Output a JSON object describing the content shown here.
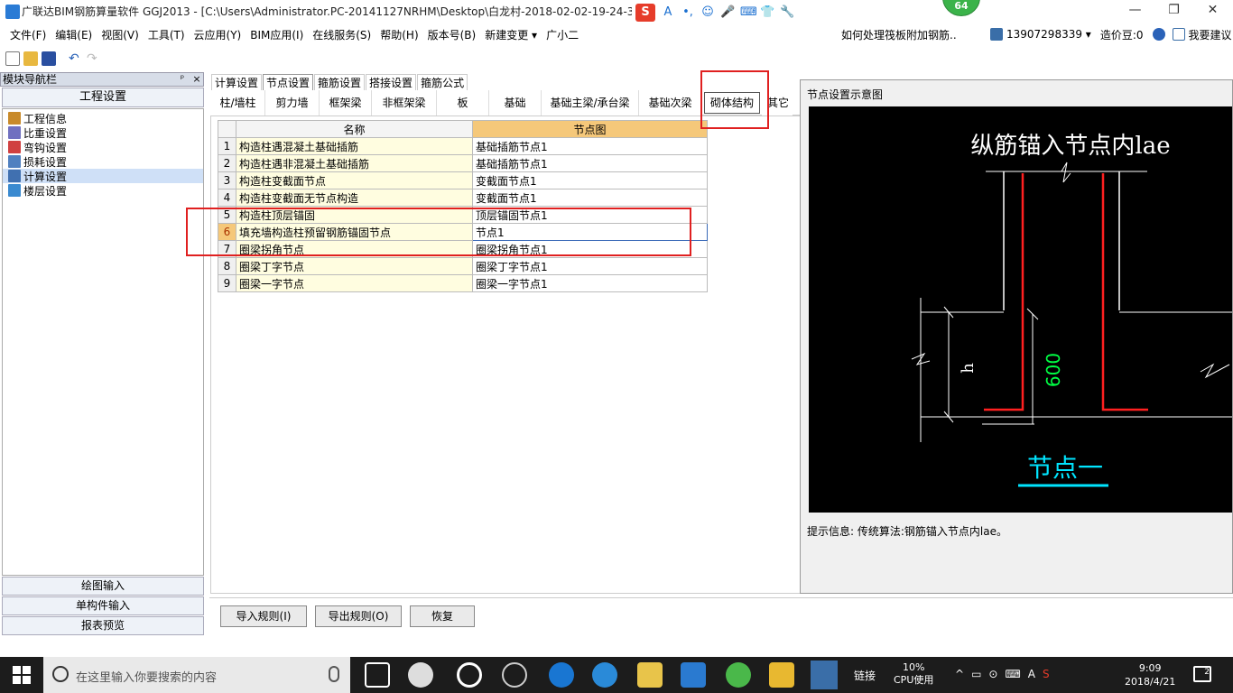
{
  "window": {
    "title": "广联达BIM钢筋算量软件 GGJ2013 - [C:\\Users\\Administrator.PC-20141127NRHM\\Desktop\\白龙村-2018-02-02-19-24-35",
    "badge": "64",
    "controls": [
      "—",
      "❐",
      "✕"
    ]
  },
  "ime": {
    "logo": "S",
    "items": [
      "A",
      "•,",
      "☺",
      "🎤",
      "⌨",
      "👕",
      "🔧"
    ]
  },
  "menu": {
    "items": [
      "文件(F)",
      "编辑(E)",
      "视图(V)",
      "工具(T)",
      "云应用(Y)",
      "BIM应用(I)",
      "在线服务(S)",
      "帮助(H)",
      "版本号(B)",
      "新建变更 ▾",
      "广小二"
    ],
    "help_link": "如何处理筏板附加钢筋..",
    "phone": "13907298339 ▾",
    "beans": "造价豆:0",
    "suggest": "我要建议"
  },
  "sidebar": {
    "header": "模块导航栏",
    "pin": "ᵖ",
    "close": "×",
    "section_title": "工程设置",
    "tree": [
      {
        "label": "工程信息",
        "icon": "info-icon",
        "color": "#c88a2a"
      },
      {
        "label": "比重设置",
        "icon": "weight-icon",
        "color": "#7070c0"
      },
      {
        "label": "弯钩设置",
        "icon": "hook-icon",
        "color": "#d04040"
      },
      {
        "label": "损耗设置",
        "icon": "loss-icon",
        "color": "#5080c0"
      },
      {
        "label": "计算设置",
        "icon": "calc-icon",
        "color": "#4070b0"
      },
      {
        "label": "楼层设置",
        "icon": "floor-icon",
        "color": "#3a8ad0"
      }
    ],
    "bottom_buttons": [
      "绘图输入",
      "单构件输入",
      "报表预览"
    ]
  },
  "main_tabs": [
    "计算设置",
    "节点设置",
    "箍筋设置",
    "搭接设置",
    "箍筋公式"
  ],
  "sub_tabs": [
    "柱/墙柱",
    "剪力墙",
    "框架梁",
    "非框架梁",
    "板",
    "基础",
    "基础主梁/承台梁",
    "基础次梁",
    "砌体结构",
    "其它"
  ],
  "grid": {
    "headers": [
      "名称",
      "节点图"
    ],
    "rows": [
      {
        "num": "1",
        "name": "构造柱遇混凝土基础插筋",
        "node": "基础插筋节点1"
      },
      {
        "num": "2",
        "name": "构造柱遇非混凝土基础插筋",
        "node": "基础插筋节点1"
      },
      {
        "num": "3",
        "name": "构造柱变截面节点",
        "node": "变截面节点1"
      },
      {
        "num": "4",
        "name": "构造柱变截面无节点构造",
        "node": "变截面节点1"
      },
      {
        "num": "5",
        "name": "构造柱顶层锚固",
        "node": "顶层锚固节点1"
      },
      {
        "num": "6",
        "name": "填充墙构造柱预留钢筋锚固节点",
        "node": "节点1"
      },
      {
        "num": "7",
        "name": "圈梁拐角节点",
        "node": "圈梁拐角节点1"
      },
      {
        "num": "8",
        "name": "圈梁丁字节点",
        "node": "圈梁丁字节点1"
      },
      {
        "num": "9",
        "name": "圈梁一字节点",
        "node": "圈梁一字节点1"
      }
    ],
    "selected_row": "6"
  },
  "buttons": {
    "import": "导入规则(I)",
    "export": "导出规则(O)",
    "restore": "恢复"
  },
  "diagram": {
    "panel_title": "节点设置示意图",
    "caption": "纵筋锚入节点内lae",
    "h_label": "h",
    "dim_label": "600",
    "node_name": "节点一",
    "hint": "提示信息: 传统算法:钢筋锚入节点内lae。"
  },
  "taskbar": {
    "search_placeholder": "在这里输入你要搜索的内容",
    "link": "链接",
    "cpu_percent": "10%",
    "cpu_label": "CPU使用",
    "tray": [
      "^",
      "▭",
      "⊙",
      "⌨",
      "A",
      "S"
    ],
    "time": "9:09",
    "date": "2018/4/21",
    "notifications": "2"
  }
}
